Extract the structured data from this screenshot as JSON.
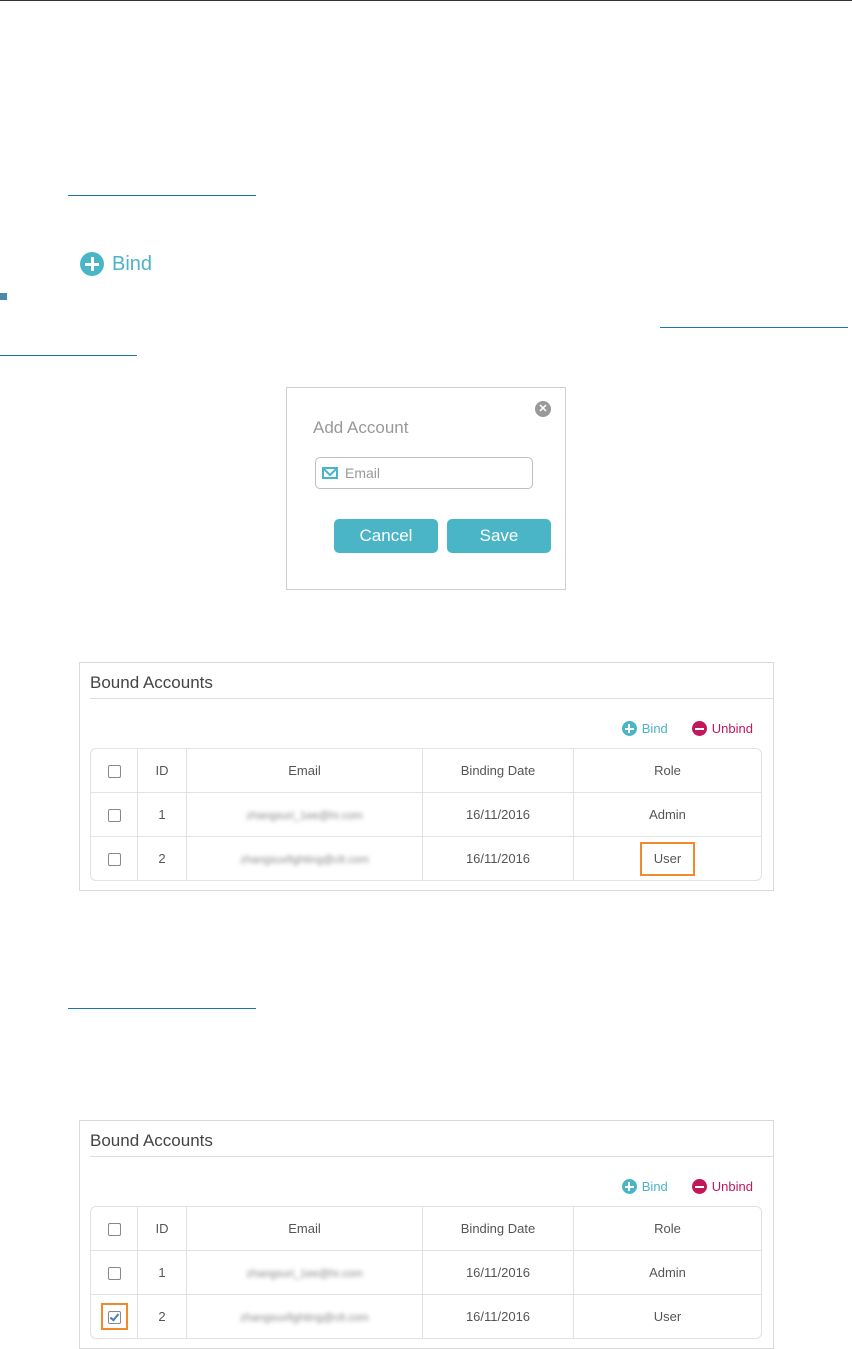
{
  "bind_link": {
    "label": "Bind"
  },
  "dialog": {
    "title": "Add Account",
    "email_placeholder": "Email",
    "cancel_label": "Cancel",
    "save_label": "Save"
  },
  "panel1": {
    "title": "Bound Accounts",
    "bind_label": "Bind",
    "unbind_label": "Unbind",
    "headers": [
      "ID",
      "Email",
      "Binding Date",
      "Role"
    ],
    "rows": [
      {
        "id": "1",
        "email": "zhangsuri_1ee@hr.com",
        "date": "16/11/2016",
        "role": "Admin"
      },
      {
        "id": "2",
        "email": "zhangsuxfighting@clt.com",
        "date": "16/11/2016",
        "role": "User"
      }
    ]
  },
  "panel2": {
    "title": "Bound Accounts",
    "bind_label": "Bind",
    "unbind_label": "Unbind",
    "headers": [
      "ID",
      "Email",
      "Binding Date",
      "Role"
    ],
    "rows": [
      {
        "id": "1",
        "email": "zhangsuri_1ee@hr.com",
        "date": "16/11/2016",
        "role": "Admin"
      },
      {
        "id": "2",
        "email": "zhangsuxfighting@clt.com",
        "date": "16/11/2016",
        "role": "User"
      }
    ]
  },
  "colors": {
    "accent": "#4bb5c8",
    "unbind": "#c2185b",
    "highlight": "#f08a2c"
  }
}
